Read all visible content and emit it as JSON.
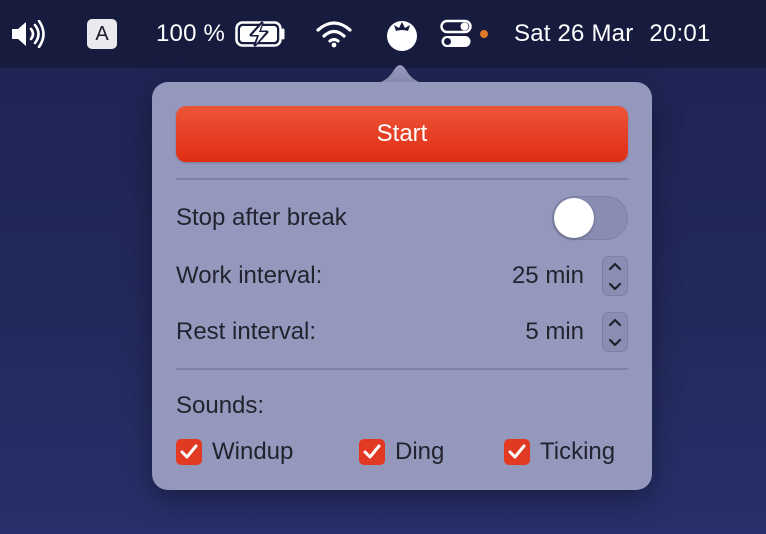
{
  "menubar": {
    "input_source": "A",
    "battery_percent": "100 %",
    "date": "Sat 26 Mar",
    "time": "20:01"
  },
  "popover": {
    "start_label": "Start",
    "stop_after_break": {
      "label": "Stop after break",
      "enabled": false
    },
    "work_interval": {
      "label": "Work interval:",
      "value": "25 min"
    },
    "rest_interval": {
      "label": "Rest interval:",
      "value": "5 min"
    },
    "sounds": {
      "label": "Sounds:",
      "items": [
        {
          "label": "Windup",
          "checked": true
        },
        {
          "label": "Ding",
          "checked": true
        },
        {
          "label": "Ticking",
          "checked": true
        }
      ]
    }
  },
  "colors": {
    "accent": "#e23a22",
    "popover_bg": "#9598bd",
    "menubar_bg": "#171b3e",
    "status_dot": "#e07a2a"
  },
  "icons": [
    "volume-icon",
    "input-source-icon",
    "battery-charging-icon",
    "wifi-icon",
    "tomato-icon",
    "control-center-icon"
  ]
}
